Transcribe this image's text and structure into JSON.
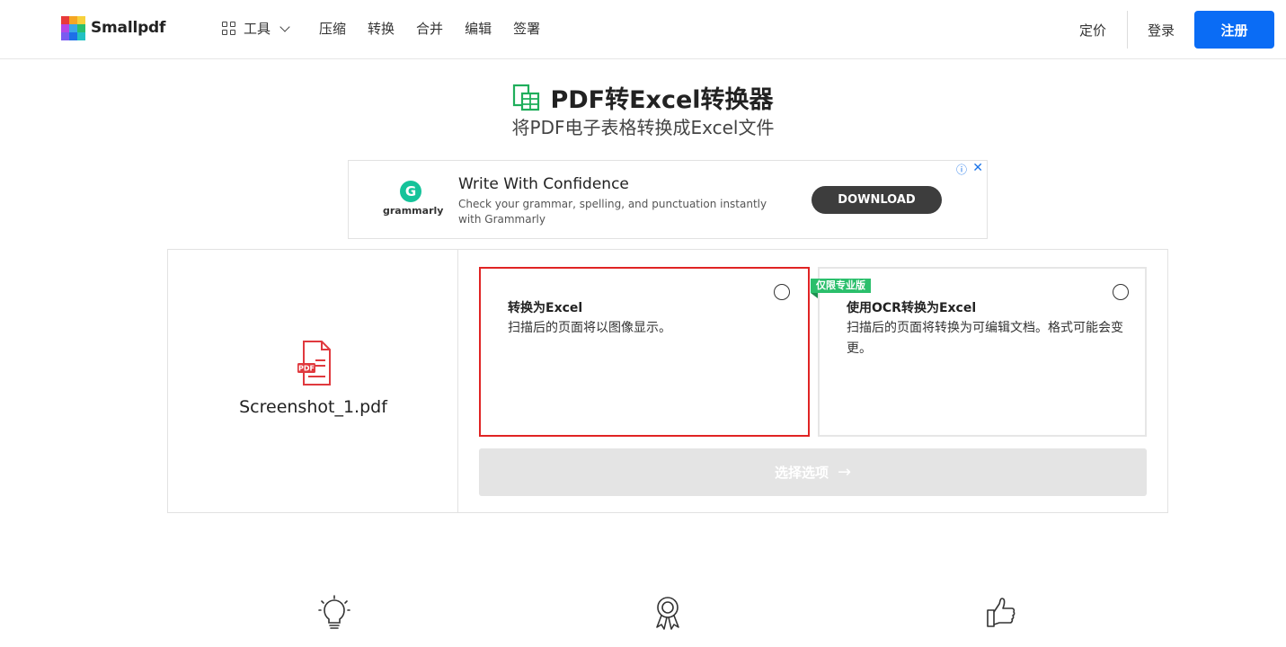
{
  "header": {
    "logo_text": "Smallpdf",
    "tools_label": "工具",
    "nav_items": [
      "压缩",
      "转换",
      "合并",
      "编辑",
      "签署"
    ],
    "pricing": "定价",
    "login": "登录",
    "signup": "注册"
  },
  "hero": {
    "title": "PDF转Excel转换器",
    "subtitle": "将PDF电子表格转换成Excel文件"
  },
  "ad": {
    "brand": "grammarly",
    "title": "Write With Confidence",
    "text": "Check your grammar, spelling, and punctuation instantly with Grammarly",
    "button": "DOWNLOAD"
  },
  "file": {
    "name": "Screenshot_1.pdf",
    "icon_label": "PDF"
  },
  "options": [
    {
      "title": "转换为Excel",
      "desc": "扫描后的页面将以图像显示。",
      "selected": false
    },
    {
      "title": "使用OCR转换为Excel",
      "desc": "扫描后的页面将转换为可编辑文档。格式可能会变更。",
      "badge": "仅限专业版",
      "selected": false
    }
  ],
  "choose_button": "选择选项",
  "colors": {
    "brand_blue": "#0a6cf5",
    "highlight_red": "#e02424",
    "pro_green": "#2bbf6c",
    "excel_green": "#1fae5b"
  },
  "feature_icons": [
    "lightbulb-icon",
    "award-ribbon-icon",
    "thumbs-up-icon"
  ]
}
